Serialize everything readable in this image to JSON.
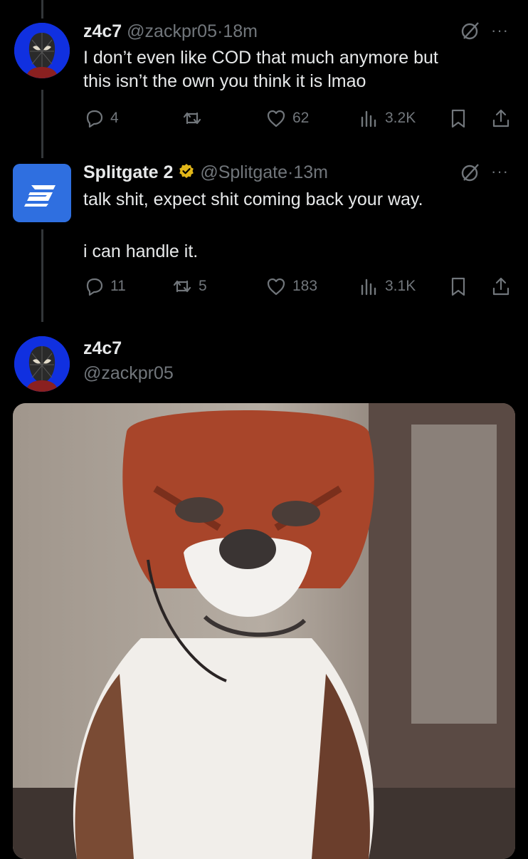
{
  "tweets": [
    {
      "name": "z4c7",
      "handle": "@zackpr05",
      "time": "18m",
      "text_lines": [
        "I don’t even like COD that much anymore but",
        "this isn’t the own you think it is lmao"
      ],
      "stats": {
        "replies": "4",
        "reposts": "",
        "likes": "62",
        "views": "3.2K"
      }
    },
    {
      "name": "Splitgate 2",
      "handle": "@Splitgate",
      "time": "13m",
      "text_lines": [
        "talk shit, expect shit coming back your way.",
        "",
        "i can handle it."
      ],
      "stats": {
        "replies": "11",
        "reposts": "5",
        "likes": "183",
        "views": "3.1K"
      }
    }
  ],
  "compose": {
    "name": "z4c7",
    "handle": "@zackpr05"
  },
  "separator": "·",
  "more_label": "···",
  "colors": {
    "background": "#000000",
    "text": "#e7e9ea",
    "muted": "#71767b",
    "verified": "#e2b719",
    "brand": "#2f6fe0"
  },
  "icons": [
    "reply-icon",
    "repost-icon",
    "like-icon",
    "views-icon",
    "bookmark-icon",
    "share-icon",
    "grok-icon",
    "more-icon",
    "verified-badge-icon"
  ]
}
